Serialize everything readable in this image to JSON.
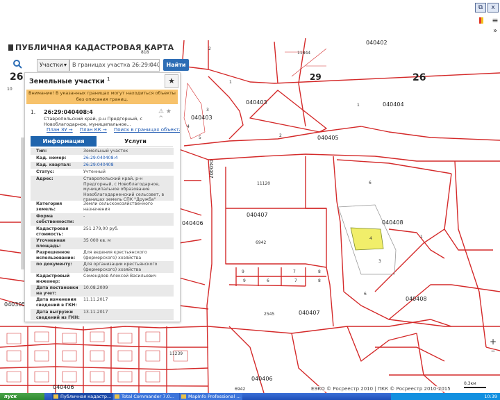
{
  "app": {
    "title": "ПУБЛИЧНАЯ КАДАСТРОВАЯ КАРТА",
    "window_controls": {
      "restore": "⧉",
      "close": "x"
    },
    "menu_icon": "≡",
    "side_icon": "flag-icon",
    "chevron": "»"
  },
  "search": {
    "type_label": "Участки",
    "type_caret": "▾",
    "query": "В границах участка 26:29:04040...",
    "clear": "×",
    "button_label": "Найти"
  },
  "panel": {
    "title": "Земельные участки",
    "title_count": "1",
    "star": "★",
    "warning": "Внимание! В указанных границах могут находиться объекты без описания границ.",
    "item": {
      "number": "1.",
      "cad_number": "26:29:040408:4",
      "address_short": "Ставропольский край, р-н Предгорный, с Новоблагодарное, муниципальное...",
      "icons": "⚠ ★ ^"
    },
    "links": [
      "План ЗУ →",
      "План КК →",
      "Поиск в границах объекта →"
    ],
    "tabs": {
      "info": "Информация",
      "services": "Услуги"
    },
    "rows": [
      {
        "label": "Тип:",
        "value": "Земельный участок"
      },
      {
        "label": "Кад. номер:",
        "value": "26:29:040408:4"
      },
      {
        "label": "Кад. квартал:",
        "value": "26:29:040408"
      },
      {
        "label": "Статус:",
        "value": "Учтенный"
      },
      {
        "label": "Адрес:",
        "value": "Ставропольский край, р-н Предгорный, с Новоблагодарное, муниципальное образование Новоблагодарненский сельсовет, в границах земель СПК \"Дружба\""
      },
      {
        "label": "Категория земель:",
        "value": "Земли сельскохозяйственного назначения"
      },
      {
        "label": "Форма собственности:",
        "value": "-"
      },
      {
        "label": "Кадастровая стоимость:",
        "value": "251 279,00 руб."
      },
      {
        "label": "Уточненная площадь:",
        "value": "35 000 кв. м"
      },
      {
        "label": "Разрешенное использование:",
        "value": "Для ведения крестьянского (фермерского) хозяйства"
      },
      {
        "label": "по документу:",
        "value": "Для организации крестьянского (фермерского) хозяйства"
      },
      {
        "label": "Кадастровый инженер:",
        "value": "Семендяев Алексей Васильевич"
      },
      {
        "label": "Дата постановки на учет:",
        "value": "10.08.2009"
      },
      {
        "label": "Дата изменения сведений в ГКН:",
        "value": "11.11.2017"
      },
      {
        "label": "Дата выгрузки сведений из ГКН:",
        "value": "13.11.2017"
      }
    ]
  },
  "map_labels": {
    "l26_left": "26",
    "l26_right": "26",
    "l29": "29",
    "q040402": "040402",
    "q040403a": "040403",
    "q040403b": "040403",
    "q040404": "040404",
    "q040405": "040405",
    "q040406a": "040406",
    "q040406b": "040406",
    "q040406c": "040406",
    "q040406d": "040406",
    "q040407a": "040407",
    "q040407b": "040407",
    "q040408a": "040408",
    "q040408b": "040408",
    "q040305": "040305",
    "n818": "818",
    "n11844": "11844",
    "n11120": "11120",
    "n6942a": "6942",
    "n6942b": "6942",
    "n2545": "2545",
    "n11239": "11239",
    "n10": "10",
    "n3": "3",
    "n4": "4",
    "n2a": "2",
    "n2b": "2",
    "n1a": "1",
    "n1b": "1",
    "n5": "5",
    "n6a": "6",
    "n6b": "6",
    "n7a": "7",
    "n7b": "7",
    "n8a": "8",
    "n8b": "8",
    "n9a": "9",
    "n9b": "9",
    "n4sel": "4",
    "n3b": "3",
    "n6c": "6",
    "n1c": "1"
  },
  "attribution": "ЕЭКО © Росреестр 2010 | ПКК © Росреестр 2010-2015",
  "scale": "0,3км",
  "zoom": {
    "in": "+",
    "out": "–"
  },
  "taskbar": {
    "start": "пуск",
    "tasks": [
      "Публичная кадастр...",
      "Total Commander 7.0...",
      "MapInfo Professional ..."
    ],
    "time": "10:39"
  },
  "colors": {
    "parcel_border": "#d42a2a",
    "selected_fill": "#f1ee6a",
    "primary_button": "#2d6db5",
    "warning_bg": "#f7c26b",
    "tab_active": "#1f64ad"
  }
}
